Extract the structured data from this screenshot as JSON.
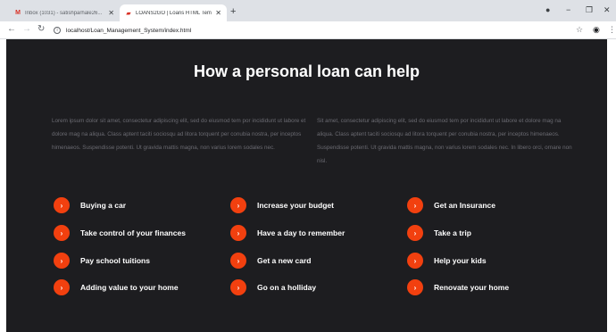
{
  "browser": {
    "tabs": [
      {
        "title": "Inbox (1031) - satishparhale26...",
        "favicon": "gmail-icon",
        "active": false
      },
      {
        "title": "LOANS2GO | Loans HTML Templ...",
        "favicon": "loans-favicon-icon",
        "active": true
      }
    ],
    "url": "localhost/Loan_Management_System/index.html"
  },
  "section": {
    "title": "How a personal loan can help",
    "paragraphs": [
      "Lorem ipsum dolor sit amet, consectetur adipiscing elit, sed do eiusmod tem por incididunt ut labore et dolore mag na aliqua. Class aptent taciti sociosqu ad litora torquent per conubia nostra, per inceptos himenaeos. Suspendisse potenti. Ut gravida mattis magna, non varius lorem sodales nec.",
      "Sit amet, consectetur adipiscing elit, sed do eiusmod tem por incididunt ut labore et dolore mag na aliqua. Class aptent taciti sociosqu ad litora torquent per conubia nostra, per inceptos himenaeos. Suspendisse potenti. Ut gravida mattis magna, non varius lorem sodales nec. In libero orci, ornare non nisl."
    ],
    "columns": [
      [
        "Buying a car",
        "Take control of your finances",
        "Pay school tuitions",
        "Adding value to your home"
      ],
      [
        "Increase your budget",
        "Have a day to remember",
        "Get a new card",
        "Go on a holliday"
      ],
      [
        "Get an Insurance",
        "Take a trip",
        "Help your kids",
        "Renovate your home"
      ]
    ],
    "bullet_glyph": "›",
    "accent_color": "#f2400f"
  }
}
